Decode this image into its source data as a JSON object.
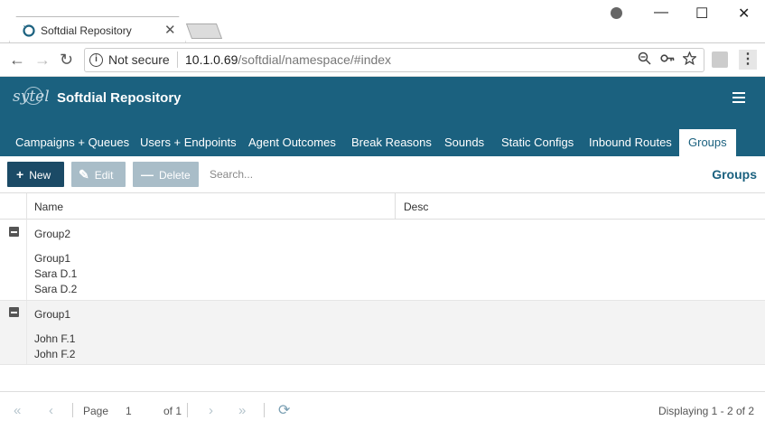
{
  "browser": {
    "tab_title": "Softdial Repository",
    "tab_close": "✕",
    "window_min": "—",
    "window_max": "☐",
    "window_close": "✕",
    "back": "←",
    "forward": "→",
    "reload": "↻",
    "not_secure": "Not secure",
    "url_host": "10.1.0.69",
    "url_path": "/softdial/namespace/#index",
    "menu": "⋮"
  },
  "app": {
    "logo_text": "sytel",
    "title": "Softdial Repository"
  },
  "nav": {
    "tabs": [
      {
        "label": "Campaigns + Queues"
      },
      {
        "label": "Users + Endpoints"
      },
      {
        "label": "Agent Outcomes"
      },
      {
        "label": "Break Reasons"
      },
      {
        "label": "Sounds"
      },
      {
        "label": "Static Configs"
      },
      {
        "label": "Inbound Routes"
      },
      {
        "label": "Groups"
      }
    ],
    "active": "Groups"
  },
  "toolbar": {
    "new_label": "New",
    "edit_label": "Edit",
    "delete_label": "Delete",
    "search_placeholder": "Search...",
    "section_title": "Groups"
  },
  "grid": {
    "columns": [
      "Name",
      "Desc"
    ],
    "rows": [
      {
        "name": "Group2",
        "members": [
          "Group1",
          "Sara D.1",
          "Sara D.2"
        ]
      },
      {
        "name": "Group1",
        "members": [
          "John F.1",
          "John F.2"
        ]
      }
    ]
  },
  "pager": {
    "page_label": "Page",
    "page_value": "1",
    "of_label": "of 1",
    "display_text": "Displaying 1 - 2 of 2"
  }
}
